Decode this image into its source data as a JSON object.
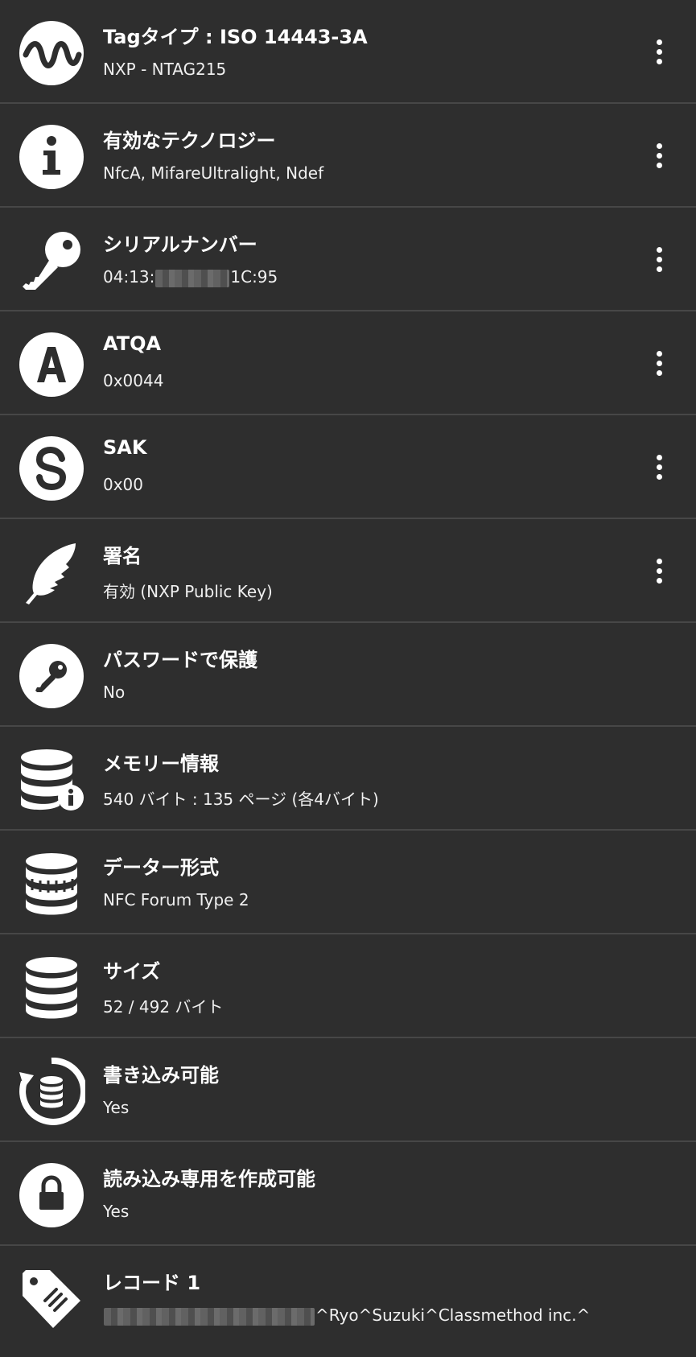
{
  "rows": [
    {
      "title": "Tagタイプ : ISO 14443-3A",
      "subtitle": "NXP - NTAG215",
      "icon": "wave-icon"
    },
    {
      "title": "有効なテクノロジー",
      "subtitle": "NfcA, MifareUltralight, Ndef",
      "icon": "info-icon"
    },
    {
      "title": "シリアルナンバー",
      "subtitle_prefix": "04:13:",
      "subtitle_suffix": "1C:95",
      "icon": "key-icon"
    },
    {
      "title": "ATQA",
      "subtitle": "0x0044",
      "icon": "letter-a-icon"
    },
    {
      "title": "SAK",
      "subtitle": "0x00",
      "icon": "letter-s-icon"
    },
    {
      "title": "署名",
      "subtitle": "有効 (NXP Public Key)",
      "icon": "feather-icon"
    },
    {
      "title": "パスワードで保護",
      "subtitle": "No",
      "icon": "key-circle-icon"
    },
    {
      "title": "メモリー情報",
      "subtitle": "540 バイト : 135 ページ (各4バイト)",
      "icon": "database-info-icon"
    },
    {
      "title": "データー形式",
      "subtitle": "NFC Forum Type 2",
      "icon": "database-stripes-icon"
    },
    {
      "title": "サイズ",
      "subtitle": "52 / 492 バイト",
      "icon": "database-icon"
    },
    {
      "title": "書き込み可能",
      "subtitle": "Yes",
      "icon": "database-refresh-icon"
    },
    {
      "title": "読み込み専用を作成可能",
      "subtitle": "Yes",
      "icon": "lock-icon"
    },
    {
      "title": "レコード 1",
      "subtitle_suffix": "^Ryo^Suzuki^Classmethod inc.^",
      "icon": "tag-icon"
    }
  ],
  "colors": {
    "background": "#2e2e2e",
    "divider": "#474747",
    "text": "#ffffff"
  }
}
